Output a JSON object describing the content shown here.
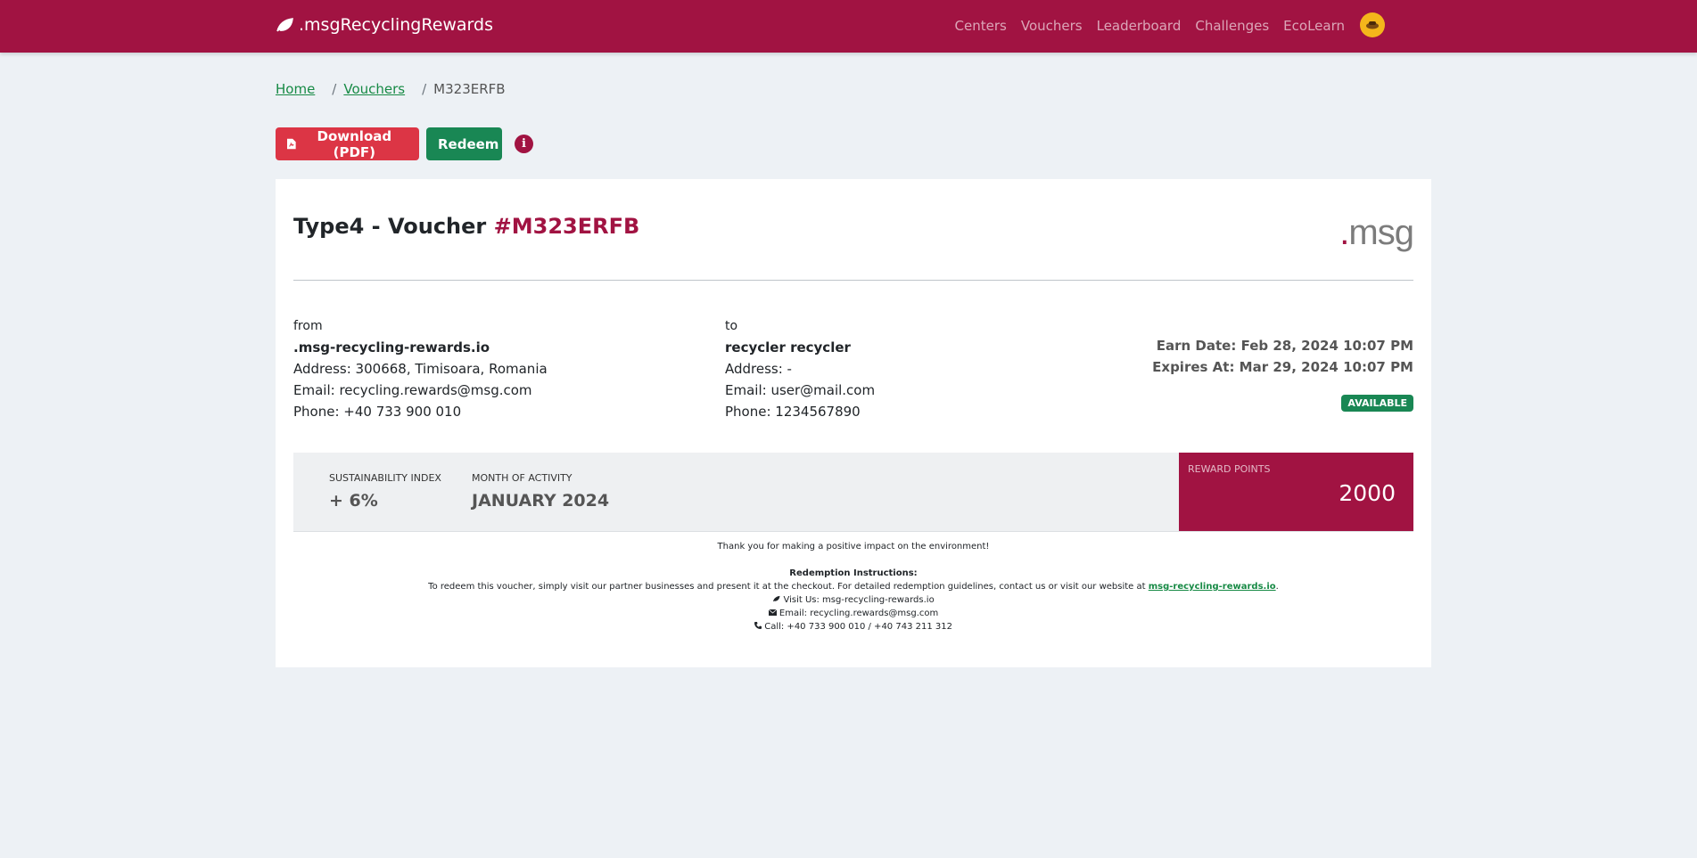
{
  "nav": {
    "brand": ".msgRecyclingRewards",
    "links": [
      "Centers",
      "Vouchers",
      "Leaderboard",
      "Challenges",
      "EcoLearn"
    ]
  },
  "breadcrumb": {
    "home": "Home",
    "vouchers": "Vouchers",
    "current": "M323ERFB",
    "separator": "/"
  },
  "actions": {
    "download_label": "Download (PDF)",
    "redeem_label": "Redeem",
    "info_icon": "i"
  },
  "voucher": {
    "title_prefix": "Type4 - Voucher ",
    "code": "#M323ERFB",
    "logo_dot": ".",
    "logo_text": "msg",
    "from": {
      "label": "from",
      "name": ".msg-recycling-rewards.io",
      "address": "Address: 300668, Timisoara, Romania",
      "email": "Email: recycling.rewards@msg.com",
      "phone": "Phone: +40 733 900 010"
    },
    "to": {
      "label": "to",
      "name": "recycler recycler",
      "address": "Address: -",
      "email": "Email: user@mail.com",
      "phone": "Phone: 1234567890"
    },
    "earn_date": "Earn Date: Feb 28, 2024 10:07 PM",
    "expires_at": "Expires At: Mar 29, 2024 10:07 PM",
    "status": "AVAILABLE",
    "sustainability_label": "SUSTAINABILITY INDEX",
    "sustainability_value": "+ 6%",
    "month_label": "MONTH OF ACTIVITY",
    "month_value": "JANUARY 2024",
    "points_label": "REWARD POINTS",
    "points_value": "2000"
  },
  "footer": {
    "thanks": "Thank you for making a positive impact on the environment!",
    "instructions_title": "Redemption Instructions:",
    "instructions_text": "To redeem this voucher, simply visit our partner businesses and present it at the checkout. For detailed redemption guidelines, contact us or visit our website at ",
    "website_link": "msg-recycling-rewards.io",
    "instructions_end": ".",
    "visit": "Visit Us: msg-recycling-rewards.io",
    "email": "Email: recycling.rewards@msg.com",
    "call": "Call: +40 733 900 010 / +40 743 211 312"
  },
  "colors": {
    "brand": "#a11342",
    "success": "#198754",
    "danger": "#dc3545",
    "avatar": "#f4b61b"
  }
}
